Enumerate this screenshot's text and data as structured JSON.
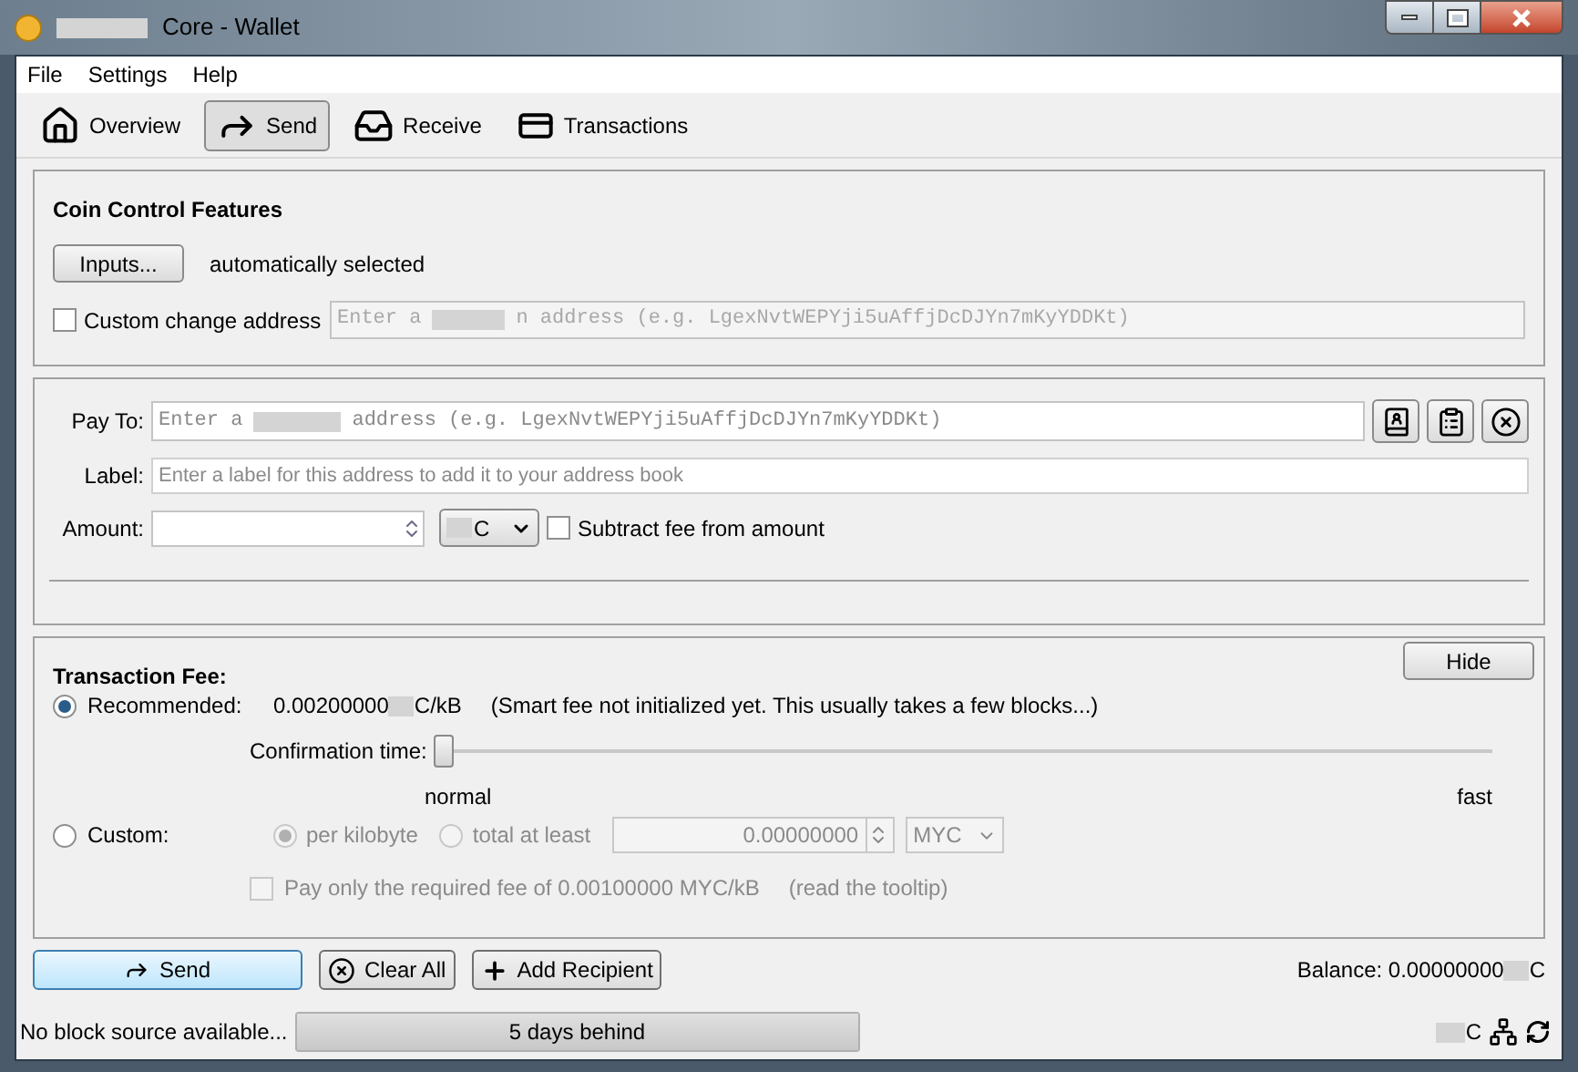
{
  "window": {
    "title": "Core - Wallet"
  },
  "menu": [
    {
      "label": "File"
    },
    {
      "label": "Settings"
    },
    {
      "label": "Help"
    }
  ],
  "tabs": [
    {
      "label": "Overview",
      "kind": "home",
      "selected": false
    },
    {
      "label": "Send",
      "kind": "send",
      "selected": true
    },
    {
      "label": "Receive",
      "kind": "receive",
      "selected": false
    },
    {
      "label": "Transactions",
      "kind": "transactions",
      "selected": false
    }
  ],
  "coin_control": {
    "title": "Coin Control Features",
    "inputs_button": "Inputs...",
    "selection": "automatically selected",
    "custom_change": {
      "label": "Custom change address",
      "checked": false,
      "placeholder_start": "Enter a",
      "placeholder_end": "n address (e.g. LgexNvtWEPYji5uAffjDcDJYn7mKyYDDKt)"
    }
  },
  "recipient": {
    "pay_to_label": "Pay To:",
    "placeholder_start": "Enter a",
    "placeholder_end": "address (e.g. LgexNvtWEPYji5uAffjDcDJYn7mKyYDDKt)",
    "label_label": "Label:",
    "label_placeholder": "Enter a label for this address to add it to your address book",
    "amount_label": "Amount:",
    "unit": "C",
    "subtract_fee": {
      "label": "Subtract fee from amount",
      "checked": false
    }
  },
  "fee": {
    "title": "Transaction Fee:",
    "hide_button": "Hide",
    "recommended": {
      "label": "Recommended:",
      "selected": true,
      "value": "0.00200000",
      "value_unit": "C/kB",
      "note": "(Smart fee not initialized yet. This usually takes a few blocks...)"
    },
    "confirmation_label": "Confirmation time:",
    "slider": {
      "level": 0
    },
    "slider_min": "normal",
    "slider_max": "fast",
    "custom": {
      "label": "Custom:",
      "selected": false,
      "options": [
        {
          "label": "per kilobyte",
          "selected": true
        },
        {
          "label": "total at least",
          "selected": false
        }
      ],
      "amount": "0.00000000",
      "unit": "MYC",
      "pay_only": {
        "label": "Pay only the required fee of 0.00100000 MYC/kB",
        "checked": false
      },
      "hint": "(read the tooltip)"
    }
  },
  "actions": [
    {
      "label": "Send",
      "kind": "send"
    },
    {
      "label": "Clear All",
      "kind": "clear"
    },
    {
      "label": "Add Recipient",
      "kind": "add"
    }
  ],
  "balance": {
    "label": "Balance: 0.00000000",
    "unit": "C"
  },
  "status_bar": {
    "message": "No block source available...",
    "progress": "5 days behind",
    "level": 1,
    "unit": "C"
  }
}
